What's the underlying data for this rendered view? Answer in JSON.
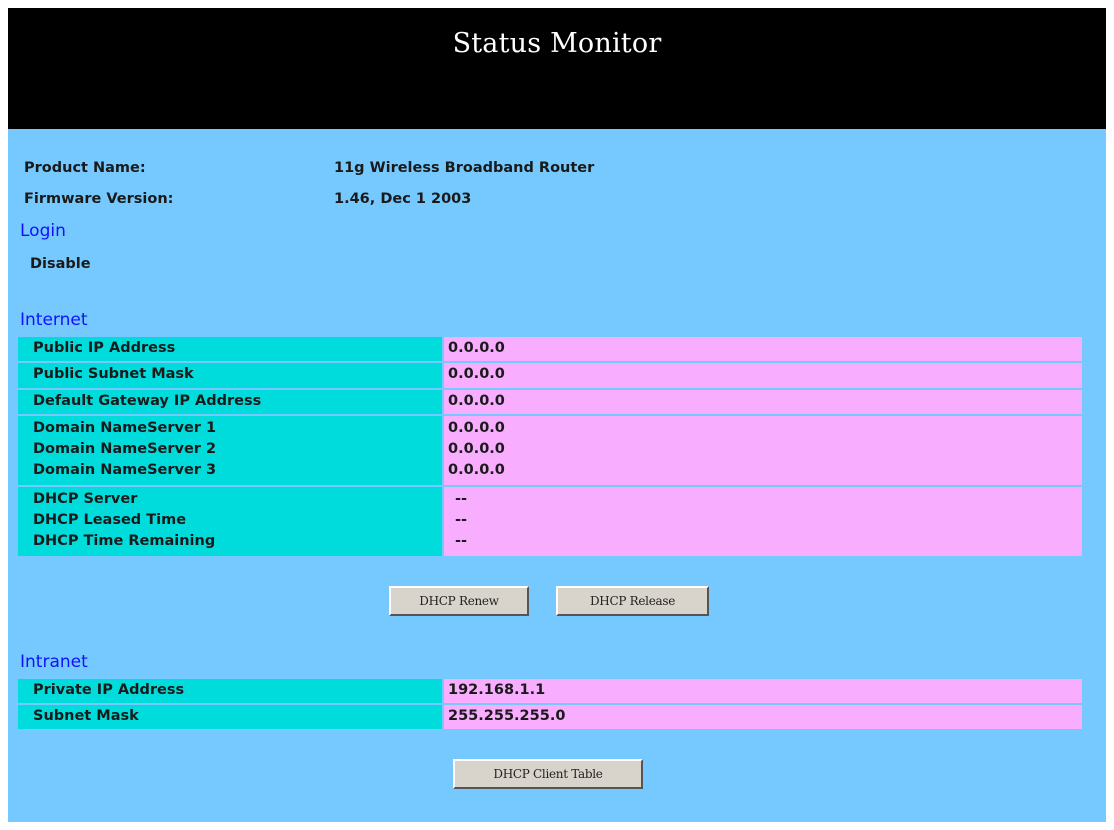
{
  "header": {
    "title": "Status Monitor"
  },
  "product": {
    "label": "Product Name:",
    "value": "11g Wireless Broadband Router"
  },
  "firmware": {
    "label": "Firmware Version:",
    "value": "1.46, Dec 1 2003"
  },
  "login": {
    "heading": "Login",
    "status": "Disable"
  },
  "internet": {
    "heading": "Internet",
    "public_ip": {
      "label": "Public IP Address",
      "value": "0.0.0.0"
    },
    "subnet": {
      "label": "Public Subnet Mask",
      "value": "0.0.0.0"
    },
    "gateway": {
      "label": "Default Gateway IP Address",
      "value": "0.0.0.0"
    },
    "dns": [
      {
        "label": "Domain NameServer 1",
        "value": "0.0.0.0"
      },
      {
        "label": "Domain NameServer 2",
        "value": "0.0.0.0"
      },
      {
        "label": "Domain NameServer 3",
        "value": "0.0.0.0"
      }
    ],
    "dhcp": [
      {
        "label": "DHCP Server",
        "value": "--"
      },
      {
        "label": "DHCP Leased Time",
        "value": "--"
      },
      {
        "label": "DHCP Time Remaining",
        "value": "--"
      }
    ],
    "buttons": {
      "renew": "DHCP Renew",
      "release": "DHCP Release"
    }
  },
  "intranet": {
    "heading": "Intranet",
    "private_ip": {
      "label": "Private IP Address",
      "value": "192.168.1.1"
    },
    "subnet": {
      "label": "Subnet Mask",
      "value": "255.255.255.0"
    },
    "client_table_button": "DHCP Client Table"
  },
  "colors": {
    "background": "#75C9FF",
    "label_cell": "#00DCDC",
    "value_cell": "#F8ADFF",
    "heading": "#1010FF",
    "header_bar": "#000000"
  }
}
